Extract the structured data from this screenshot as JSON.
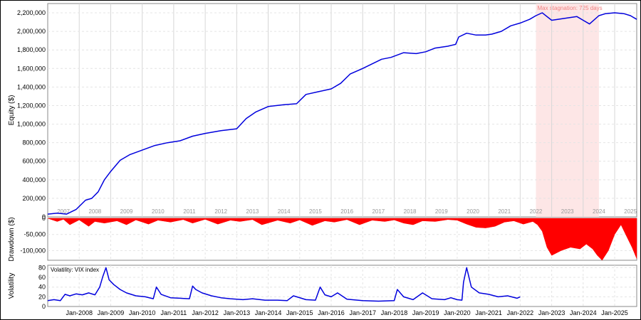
{
  "chart_data": [
    {
      "type": "line",
      "ylabel": "Equity ($)",
      "ylim": [
        0,
        2300000
      ],
      "yticks": [
        0,
        200000,
        400000,
        600000,
        800000,
        1000000,
        1200000,
        1400000,
        1600000,
        1800000,
        2000000,
        2200000
      ],
      "ytick_labels": [
        "0",
        "200,000",
        "400,000",
        "600,000",
        "800,000",
        "1,000,000",
        "1,200,000",
        "1,400,000",
        "1,600,000",
        "1,800,000",
        "2,000,000",
        "2,200,000"
      ],
      "xlim": [
        2007.0,
        2025.7
      ],
      "year_labels": [
        "2007",
        "2008",
        "2009",
        "2010",
        "2011",
        "2012",
        "2013",
        "2014",
        "2015",
        "2016",
        "2017",
        "2018",
        "2019",
        "2020",
        "2021",
        "2022",
        "2023",
        "2024",
        "2025"
      ],
      "annotation": {
        "text": "Max stagnation: 725 days",
        "x_start": 2022.5,
        "x_end": 2024.5
      },
      "series": [
        {
          "color": "#0000dd",
          "x": [
            2007.0,
            2007.3,
            2007.6,
            2007.9,
            2008.2,
            2008.4,
            2008.6,
            2008.8,
            2009.0,
            2009.3,
            2009.6,
            2010.0,
            2010.4,
            2010.8,
            2011.2,
            2011.6,
            2012.0,
            2012.5,
            2013.0,
            2013.3,
            2013.6,
            2014.0,
            2014.5,
            2014.9,
            2015.2,
            2015.6,
            2016.0,
            2016.3,
            2016.6,
            2017.0,
            2017.3,
            2017.6,
            2017.9,
            2018.3,
            2018.7,
            2019.0,
            2019.3,
            2019.7,
            2019.95,
            2020.05,
            2020.3,
            2020.6,
            2020.9,
            2021.1,
            2021.4,
            2021.7,
            2022.0,
            2022.3,
            2022.5,
            2022.7,
            2023.0,
            2023.4,
            2023.8,
            2024.0,
            2024.2,
            2024.5,
            2024.7,
            2025.0,
            2025.3,
            2025.5,
            2025.7
          ],
          "y": [
            30000,
            40000,
            30000,
            80000,
            180000,
            200000,
            270000,
            400000,
            490000,
            610000,
            670000,
            720000,
            770000,
            800000,
            820000,
            870000,
            900000,
            930000,
            950000,
            1060000,
            1130000,
            1190000,
            1210000,
            1220000,
            1320000,
            1350000,
            1380000,
            1440000,
            1540000,
            1600000,
            1650000,
            1700000,
            1720000,
            1770000,
            1760000,
            1780000,
            1820000,
            1840000,
            1860000,
            1940000,
            1980000,
            1960000,
            1960000,
            1970000,
            2000000,
            2060000,
            2090000,
            2130000,
            2170000,
            2200000,
            2120000,
            2140000,
            2160000,
            2120000,
            2080000,
            2170000,
            2190000,
            2200000,
            2190000,
            2170000,
            2130000
          ]
        }
      ]
    },
    {
      "type": "area",
      "ylabel": "Drawdown ($)",
      "ylim": [
        -130000,
        0
      ],
      "yticks": [
        0,
        -50000,
        -100000
      ],
      "ytick_labels": [
        "0",
        "-50,000",
        "-100,000"
      ],
      "xlim": [
        2007.0,
        2025.7
      ],
      "series": [
        {
          "color": "#ff0000",
          "x": [
            2007.0,
            2007.3,
            2007.5,
            2007.7,
            2008.0,
            2008.3,
            2008.5,
            2008.8,
            2009.2,
            2009.5,
            2009.8,
            2010.2,
            2010.5,
            2010.9,
            2011.3,
            2011.6,
            2012.0,
            2012.4,
            2012.8,
            2013.1,
            2013.5,
            2013.8,
            2014.3,
            2014.7,
            2015.0,
            2015.4,
            2015.8,
            2016.1,
            2016.5,
            2016.9,
            2017.3,
            2017.7,
            2018.0,
            2018.3,
            2018.6,
            2018.9,
            2019.3,
            2019.7,
            2020.0,
            2020.3,
            2020.6,
            2020.9,
            2021.2,
            2021.5,
            2021.8,
            2022.1,
            2022.4,
            2022.55,
            2022.7,
            2022.85,
            2023.0,
            2023.3,
            2023.6,
            2023.9,
            2024.1,
            2024.3,
            2024.45,
            2024.6,
            2024.8,
            2025.0,
            2025.2,
            2025.4,
            2025.55,
            2025.7
          ],
          "y": [
            0,
            -10000,
            -3000,
            -20000,
            -5000,
            -25000,
            -10000,
            -15000,
            -8000,
            -20000,
            -5000,
            -18000,
            -6000,
            -12000,
            -4000,
            -15000,
            -3000,
            -18000,
            -6000,
            -10000,
            -4000,
            -20000,
            -6000,
            -15000,
            -5000,
            -22000,
            -8000,
            -12000,
            -4000,
            -20000,
            -6000,
            -10000,
            -5000,
            -15000,
            -20000,
            -8000,
            -10000,
            -4000,
            -6000,
            -18000,
            -28000,
            -30000,
            -25000,
            -12000,
            -8000,
            -18000,
            -10000,
            -20000,
            -40000,
            -90000,
            -115000,
            -100000,
            -90000,
            -95000,
            -80000,
            -95000,
            -115000,
            -130000,
            -100000,
            -50000,
            -20000,
            -60000,
            -90000,
            -125000
          ]
        }
      ]
    },
    {
      "type": "line",
      "title": "Volatility: VIX index",
      "ylabel": "Volatility",
      "ylim": [
        0,
        85
      ],
      "yticks": [
        0,
        20,
        40,
        60,
        80
      ],
      "ytick_labels": [
        "0",
        "20",
        "40",
        "60",
        "80"
      ],
      "xlim": [
        2007.0,
        2025.7
      ],
      "x_tick_labels": [
        "Jan-2008",
        "Jan-2009",
        "Jan-2010",
        "Jan-2011",
        "Jan-2012",
        "Jan-2013",
        "Jan-2014",
        "Jan-2015",
        "Jan-2016",
        "Jan-2017",
        "Jan-2018",
        "Jan-2019",
        "Jan-2020",
        "Jan-2021",
        "Jan-2022",
        "Jan-2023",
        "Jan-2024",
        "Jan-2025"
      ],
      "x_tick_values": [
        2008,
        2009,
        2010,
        2011,
        2012,
        2013,
        2014,
        2015,
        2016,
        2017,
        2018,
        2019,
        2020,
        2021,
        2022,
        2023,
        2024,
        2025
      ],
      "series": [
        {
          "color": "#0000dd",
          "x": [
            2007.0,
            2007.2,
            2007.4,
            2007.55,
            2007.7,
            2007.9,
            2008.1,
            2008.3,
            2008.5,
            2008.65,
            2008.75,
            2008.85,
            2008.95,
            2009.1,
            2009.3,
            2009.5,
            2009.8,
            2010.1,
            2010.35,
            2010.45,
            2010.6,
            2010.9,
            2011.2,
            2011.5,
            2011.6,
            2011.7,
            2011.9,
            2012.2,
            2012.5,
            2012.8,
            2013.2,
            2013.5,
            2013.9,
            2014.3,
            2014.6,
            2014.8,
            2015.2,
            2015.5,
            2015.65,
            2015.8,
            2016.0,
            2016.2,
            2016.5,
            2017.0,
            2017.5,
            2018.0,
            2018.1,
            2018.3,
            2018.6,
            2018.9,
            2019.2,
            2019.6,
            2019.8,
            2020.0,
            2020.15,
            2020.2,
            2020.3,
            2020.45,
            2020.7,
            2021.0,
            2021.3,
            2021.6,
            2021.9,
            2022.0
          ],
          "y": [
            12,
            14,
            12,
            25,
            22,
            26,
            24,
            28,
            24,
            40,
            62,
            80,
            55,
            45,
            35,
            28,
            22,
            20,
            16,
            40,
            25,
            18,
            17,
            16,
            42,
            35,
            28,
            22,
            18,
            16,
            14,
            16,
            13,
            13,
            12,
            22,
            14,
            13,
            40,
            24,
            20,
            28,
            15,
            12,
            11,
            12,
            35,
            20,
            14,
            28,
            16,
            14,
            18,
            14,
            13,
            50,
            80,
            40,
            28,
            25,
            20,
            22,
            17,
            20
          ]
        }
      ]
    }
  ]
}
